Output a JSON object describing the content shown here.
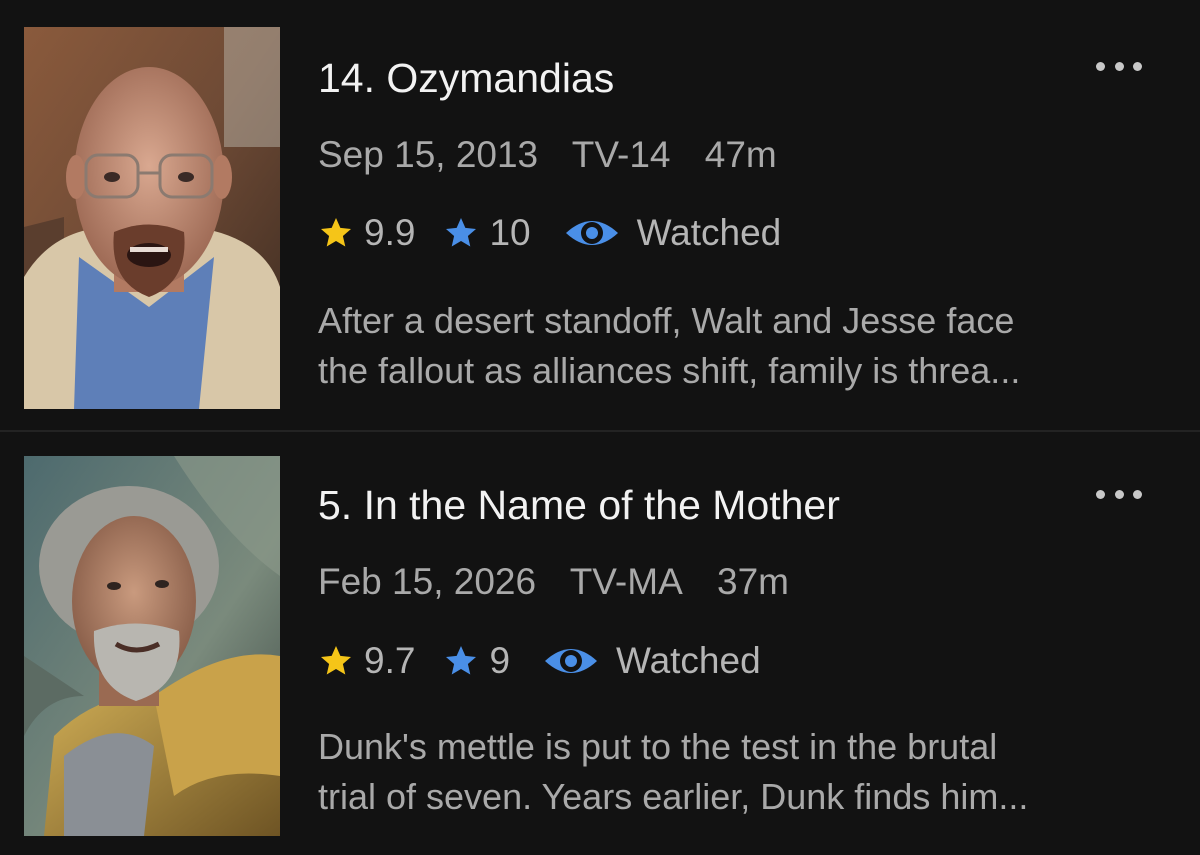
{
  "episodes": [
    {
      "title": "14. Ozymandias",
      "air_date": "Sep 15, 2013",
      "content_rating": "TV-14",
      "runtime": "47m",
      "public_rating": "9.9",
      "user_rating": "10",
      "status": "Watched",
      "description_lines": [
        "After a desert standoff, Walt and Jesse face",
        "the fallout as alliances shift, family is threa..."
      ],
      "thumbnail": "bald-man-glasses-goatee-desert-still"
    },
    {
      "title": "5. In the Name of the Mother",
      "air_date": "Feb 15, 2026",
      "content_rating": "TV-MA",
      "runtime": "37m",
      "public_rating": "9.7",
      "user_rating": "9",
      "status": "Watched",
      "description_lines": [
        "Dunk's mettle is put to the test in the brutal",
        "trial of seven. Years earlier, Dunk finds him..."
      ],
      "thumbnail": "grey-haired-knight-in-gold-armor-still"
    }
  ],
  "colors": {
    "background": "#121212",
    "title": "#f2f2f2",
    "secondary_text": "#a9a9a9",
    "public_star": "#f5c518",
    "user_star": "#4a8fe7",
    "watched_eye": "#4a8fe7"
  },
  "icons": {
    "public_rating": "star-icon-yellow",
    "user_rating": "star-icon-blue",
    "watched": "eye-icon",
    "more": "more-options-icon"
  }
}
